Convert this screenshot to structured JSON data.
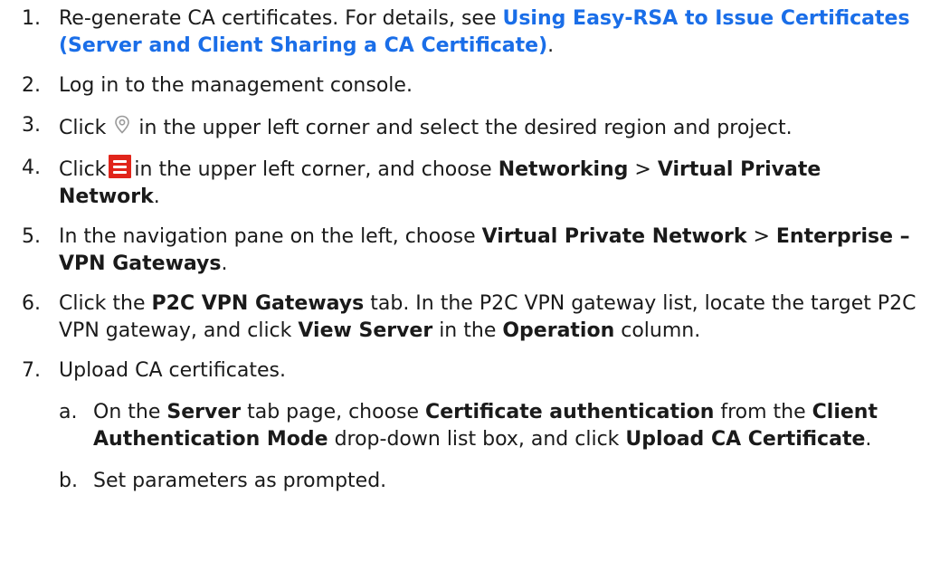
{
  "steps": [
    {
      "num": "1.",
      "pre": "Re-generate CA certificates. For details, see ",
      "link": "Using Easy-RSA to Issue Certificates (Server and Client Sharing a CA Certificate)",
      "post": "."
    },
    {
      "num": "2.",
      "text": "Log in to the management console."
    },
    {
      "num": "3.",
      "pre": "Click",
      "post": "in the upper left corner and select the desired region and project.",
      "icon": "location-pin-icon"
    },
    {
      "num": "4.",
      "pre": "Click",
      "mid": "in the upper left corner, and choose ",
      "b1": "Networking",
      "sep": " > ",
      "b2": "Virtual Private Network",
      "post": ".",
      "icon": "menu-icon"
    },
    {
      "num": "5.",
      "pre": "In the navigation pane on the left, choose ",
      "b1": "Virtual Private Network",
      "sep": " > ",
      "b2": "Enterprise – VPN Gateways",
      "post": "."
    },
    {
      "num": "6.",
      "pre": "Click the ",
      "b1": "P2C VPN Gateways",
      "mid": " tab. In the P2C VPN gateway list, locate the target P2C VPN gateway, and click ",
      "b2": "View Server",
      "mid2": " in the ",
      "b3": "Operation",
      "post": " column."
    },
    {
      "num": "7.",
      "text": "Upload CA certificates."
    }
  ],
  "substeps": [
    {
      "num": "a.",
      "pre": "On the ",
      "b1": "Server",
      "mid": " tab page, choose ",
      "b2": "Certificate authentication",
      "mid2": " from the ",
      "b3": "Client Authentication Mode",
      "mid3": " drop-down list box, and click ",
      "b4": "Upload CA Certificate",
      "post": "."
    },
    {
      "num": "b.",
      "text": "Set parameters as prompted."
    }
  ],
  "colors": {
    "link": "#1a6ee8",
    "menu_icon": "#e1251b",
    "pin_icon": "#9a9a9a"
  }
}
